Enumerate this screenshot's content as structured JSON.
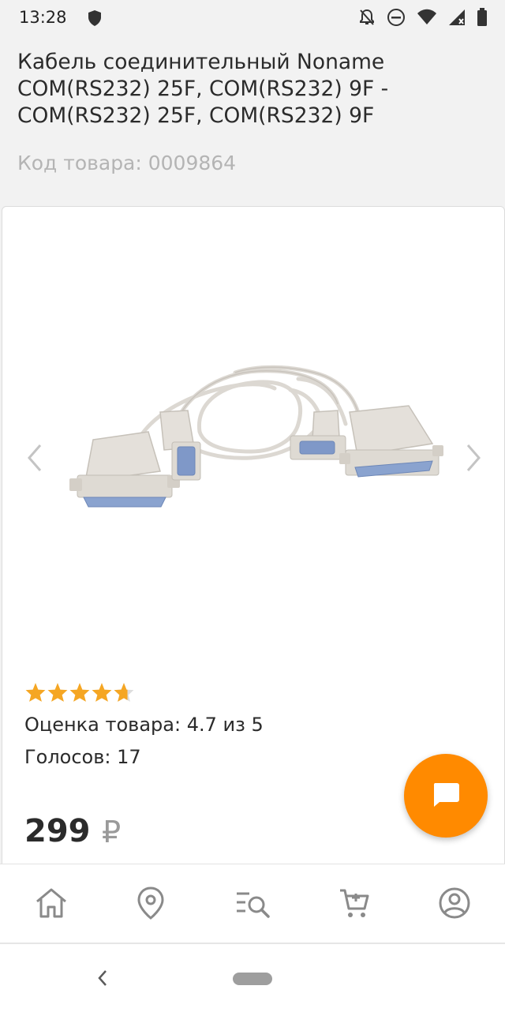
{
  "status_bar": {
    "time": "13:28",
    "icons": [
      "shield-icon",
      "notifications-off-icon",
      "do-not-disturb-icon",
      "wifi-icon",
      "signal-icon",
      "battery-icon"
    ]
  },
  "product": {
    "title": "Кабель соединительный Noname COM(RS232) 25F, COM(RS232) 9F - COM(RS232) 25F, COM(RS232) 9F",
    "code": "Код товара: 0009864",
    "rating_value": 4.7,
    "rating_max": 5,
    "rating_text": "Оценка товара: 4.7 из 5",
    "votes_text": "Голосов: 17",
    "price": "299",
    "currency": "₽"
  },
  "gallery": {
    "prev_icon": "chevron-left-icon",
    "next_icon": "chevron-right-icon"
  },
  "bottom_nav": {
    "items": [
      {
        "icon": "home-icon"
      },
      {
        "icon": "location-pin-icon"
      },
      {
        "icon": "catalog-search-icon"
      },
      {
        "icon": "cart-icon"
      },
      {
        "icon": "profile-icon"
      }
    ]
  },
  "colors": {
    "accent": "#ff8a00",
    "star": "#f5a623",
    "muted_text": "#b4b4b4",
    "icon_gray": "#8a8a8a"
  }
}
